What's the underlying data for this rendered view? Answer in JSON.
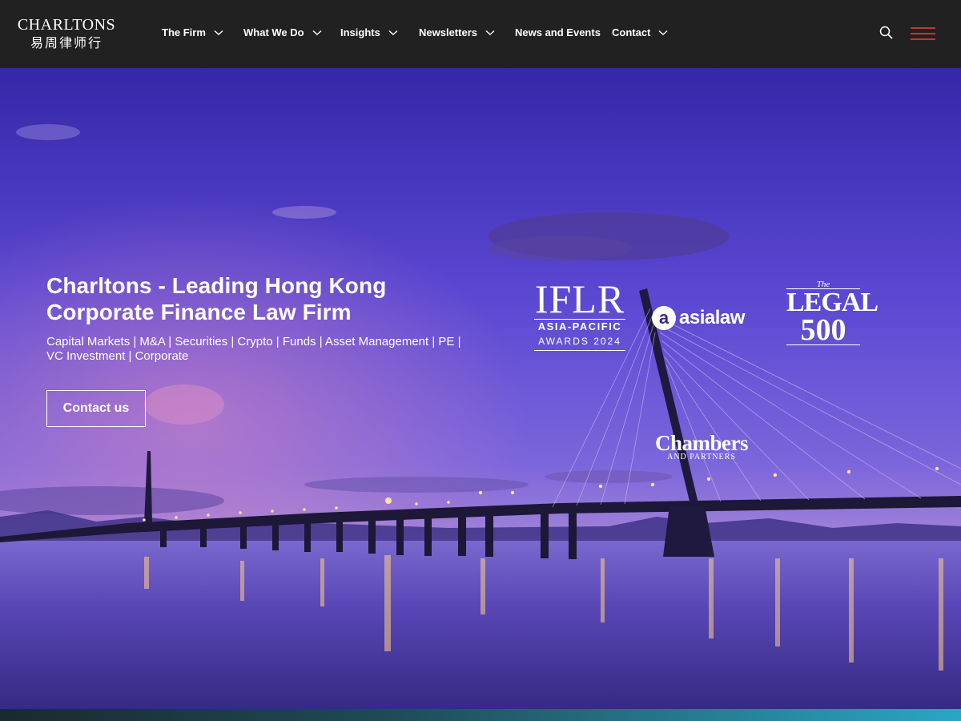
{
  "header": {
    "logo": {
      "english": "CHARLTONS",
      "chinese": "易周律师行"
    },
    "nav": [
      {
        "label": "The Firm",
        "has_dropdown": true
      },
      {
        "label": "What We Do",
        "has_dropdown": true
      },
      {
        "label": "Insights",
        "has_dropdown": true
      },
      {
        "label": "Newsletters",
        "has_dropdown": true
      },
      {
        "label": "News and Events",
        "has_dropdown": false
      },
      {
        "label": "Contact",
        "has_dropdown": true
      }
    ],
    "icons": {
      "search": "search-icon",
      "menu": "hamburger-menu-icon"
    },
    "menu_accent_color": "#c0392b"
  },
  "hero": {
    "title_line1": "Charltons - Leading Hong Kong",
    "title_line2": "Corporate Finance Law Firm",
    "subtitle": "Capital Markets | M&A | Securities | Crypto | Funds | Asset Management | PE | VC Investment | Corporate",
    "cta_label": "Contact us"
  },
  "awards": {
    "iflr": {
      "main": "IFLR",
      "region": "ASIA-PACIFIC",
      "year": "AWARDS 2024"
    },
    "asialaw": {
      "mark": "a",
      "name": "asialaw"
    },
    "legal500": {
      "the": "The",
      "legal": "LEGAL",
      "number": "500"
    },
    "chambers": {
      "main": "Chambers",
      "sub": "AND PARTNERS"
    }
  },
  "colors": {
    "header_bg": "#212121",
    "sky_top": "#3b2fb0",
    "sky_mid": "#6a4fd6",
    "horizon": "#b58ad0",
    "water": "#4a3fa8"
  }
}
